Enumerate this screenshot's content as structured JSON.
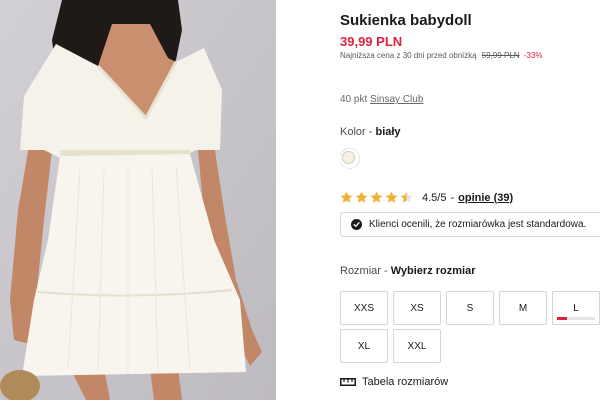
{
  "product": {
    "title": "Sukienka babydoll",
    "price": "39,99 PLN",
    "lowest_price_label": "Najniższa cena z 30 dni przed obniżką",
    "old_price": "59,99 PLN",
    "discount": "-33%",
    "image_alt": "white babydoll dress photo"
  },
  "loyalty": {
    "points_text": "40 pkt",
    "club_link": "Sinsay Club"
  },
  "color": {
    "label": "Kolor -",
    "value": "biały",
    "swatch_hex": "#f4f0e4"
  },
  "rating": {
    "stars_filled": 4.5,
    "stars_max": 5,
    "score_text": "4.5/5",
    "separator": "-",
    "reviews_link": "opinie (39)",
    "star_color": "#f2b22f"
  },
  "fit_badge": {
    "text": "Klienci ocenili, że rozmiarówka jest standardowa."
  },
  "sizes": {
    "label": "Rozmiar -",
    "prompt": "Wybierz rozmiar",
    "options": [
      "XXS",
      "XS",
      "S",
      "M",
      "L",
      "XL",
      "XXL"
    ],
    "low_stock": {
      "size": "L",
      "fraction": 0.25
    }
  },
  "size_guide": {
    "label": "Tabela rozmiarów",
    "icon": "ruler-icon"
  },
  "colors": {
    "accent_red": "#e0223d",
    "text_dark": "#1a1a1a",
    "border": "#d6d6d6"
  }
}
